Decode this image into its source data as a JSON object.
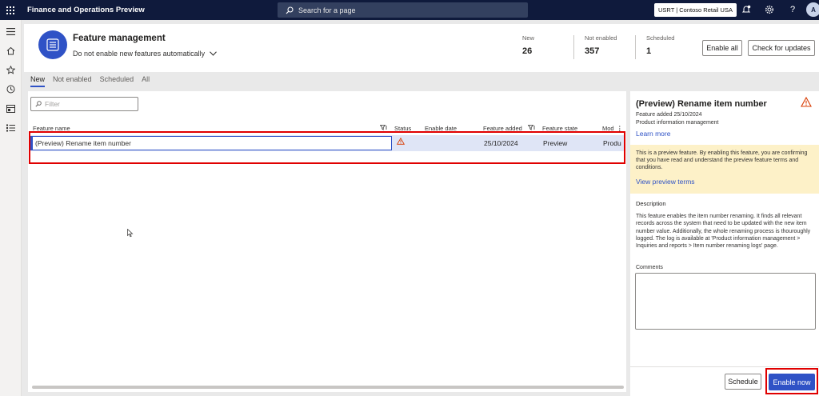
{
  "topbar": {
    "app_title": "Finance and Operations Preview",
    "search_placeholder": "Search for a page",
    "company": "USRT | Contoso Retail USA",
    "avatar_initial": "A"
  },
  "header": {
    "title": "Feature management",
    "auto_enable": "Do not enable new features automatically",
    "stats": [
      {
        "label": "New",
        "value": "26"
      },
      {
        "label": "Not enabled",
        "value": "357"
      },
      {
        "label": "Scheduled",
        "value": "1"
      }
    ],
    "enable_all_label": "Enable all",
    "check_updates_label": "Check for updates"
  },
  "tabs": [
    {
      "label": "New",
      "active": true
    },
    {
      "label": "Not enabled",
      "active": false
    },
    {
      "label": "Scheduled",
      "active": false
    },
    {
      "label": "All",
      "active": false
    }
  ],
  "grid": {
    "filter_placeholder": "Filter",
    "columns": [
      "Feature name",
      "Status",
      "Enable date",
      "Feature added",
      "Feature state",
      "Mod"
    ],
    "rows": [
      {
        "name": "(Preview) Rename item number",
        "status": "warning",
        "enable_date": "",
        "feature_added": "25/10/2024",
        "feature_state": "Preview",
        "module": "Produ"
      }
    ]
  },
  "details": {
    "title": "(Preview) Rename item number",
    "feature_added": "Feature added 25/10/2024",
    "module": "Product information management",
    "learn_more": "Learn more",
    "notice": "This is a preview feature. By enabling this feature, you are confirming that you have read and understand the preview feature terms and conditions.",
    "view_terms": "View preview terms",
    "description_label": "Description",
    "description": "This feature enables the item number renaming. It finds all relevant records across the system that need to be updated with the new item number value. Additionally, the whole renaming process is thouroughly logged. The log is available at 'Product information management > Inquiries and reports > Item number renaming logs' page.",
    "comments_label": "Comments",
    "schedule_label": "Schedule",
    "enable_now_label": "Enable now"
  },
  "colors": {
    "topbar": "#0f1a3c",
    "accent": "#2f52c6",
    "highlight": "#e00000",
    "warning": "#d83b01",
    "notice_bg": "#fdf1c8"
  }
}
